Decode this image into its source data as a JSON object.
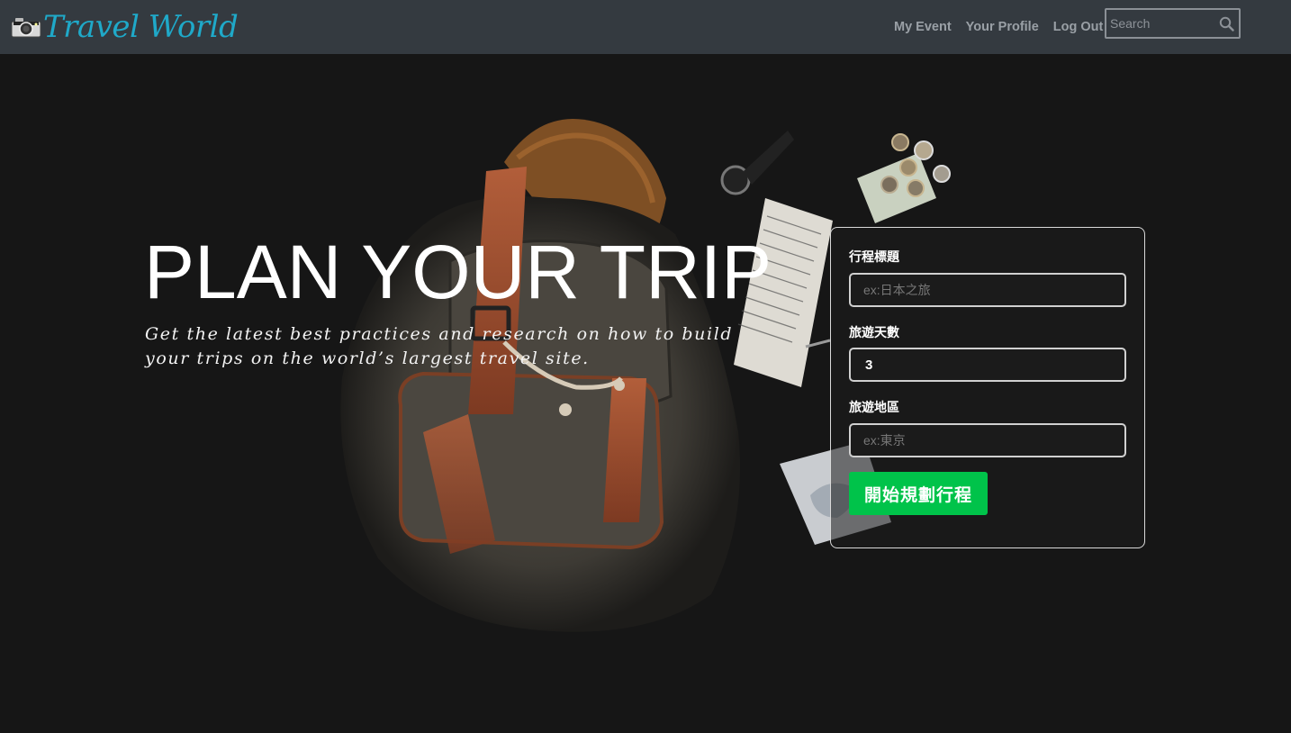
{
  "header": {
    "brand": "Travel World",
    "brand_icon": "camera-icon",
    "brand_color": "#1fa9c9",
    "nav": [
      {
        "label": "My Event"
      },
      {
        "label": "Your Profile"
      },
      {
        "label": "Log Out"
      }
    ],
    "search": {
      "placeholder": "Search",
      "icon": "search-icon"
    }
  },
  "hero": {
    "title": "PLAN YOUR TRIP",
    "subtitle": "Get the latest best practices and research on how to build your trips on the world’s largest travel site."
  },
  "form": {
    "title_label": "行程標題",
    "title_placeholder": "ex:日本之旅",
    "days_label": "旅遊天數",
    "days_value": "3",
    "region_label": "旅遊地區",
    "region_placeholder": "ex:東京",
    "submit_label": "開始規劃行程",
    "submit_color": "#00c34a"
  }
}
